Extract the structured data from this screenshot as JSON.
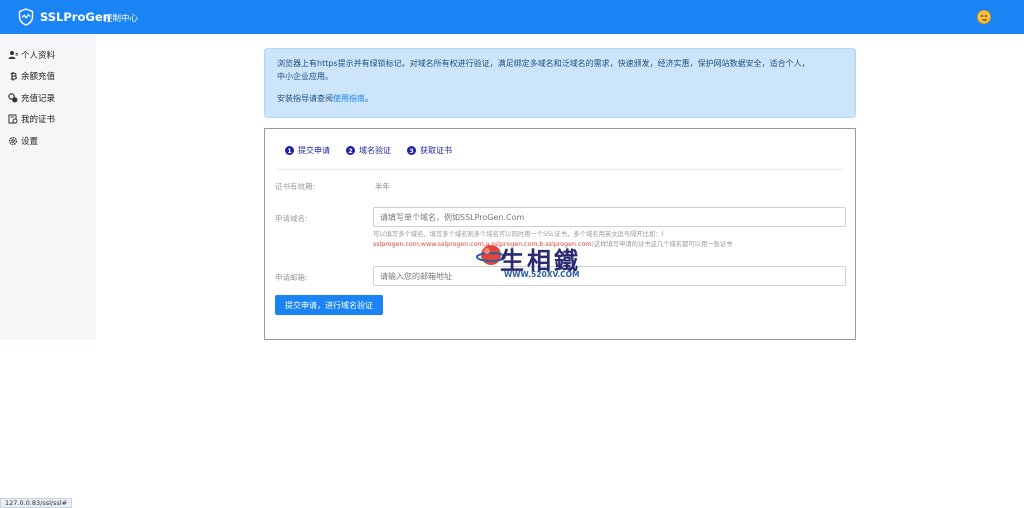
{
  "nav": {
    "brand": "SSLProGen",
    "link": "控制中心"
  },
  "sidebar": {
    "items": [
      {
        "label": "个人资料",
        "icon": "user-icon"
      },
      {
        "label": "余额充值",
        "icon": "bitcoin-icon"
      },
      {
        "label": "充值记录",
        "icon": "records-icon"
      },
      {
        "label": "我的证书",
        "icon": "certificate-icon"
      },
      {
        "label": "设置",
        "icon": "gear-icon"
      }
    ]
  },
  "alert": {
    "line1": "浏览器上有https提示并有绿锁标记。对域名所有权进行验证，满足绑定多域名和泛域名的需求，快速颁发，经济实惠，保护网站数据安全，适合个人，",
    "line2": "中小企业应用。",
    "guide_prefix": "安装指导请查阅",
    "guide_link": "使用指南",
    "guide_suffix": "。"
  },
  "steps": [
    {
      "num": "1",
      "label": "提交申请"
    },
    {
      "num": "2",
      "label": "域名验证"
    },
    {
      "num": "3",
      "label": "获取证书"
    }
  ],
  "form": {
    "validity_label": "证书有效期:",
    "validity_value": "半年",
    "domain_label": "申请域名:",
    "domain_placeholder": "请填写单个域名，例如SSLProGen.Com",
    "help_line1": "可以填写多个域名，填写多个域名则多个域名可以同时用一个SSL证书，多个域名用英文逗号隔开比如：(",
    "help_line2_red": "sslprogen.com,www.sslprogen.com,a.sslprogen.com,b.sslprogen.com",
    "help_line2_grey": ")这样填写申请的证书这几个域名都可以用一张证书",
    "email_label": "申请邮箱:",
    "email_placeholder": "请输入您的邮箱地址",
    "submit_label": "提交申请，进行域名验证"
  },
  "watermark": {
    "title": "生相鐵",
    "subtitle": "WWW.520XV.COM"
  },
  "status": {
    "url": "127.0.0.83/ssl/ssl#"
  },
  "colors": {
    "primary": "#1a84f5",
    "sidebar_bg": "#f5f6f7",
    "alert_bg": "#cce5fb",
    "step": "#1b1faa",
    "help_red": "#e0453a"
  }
}
